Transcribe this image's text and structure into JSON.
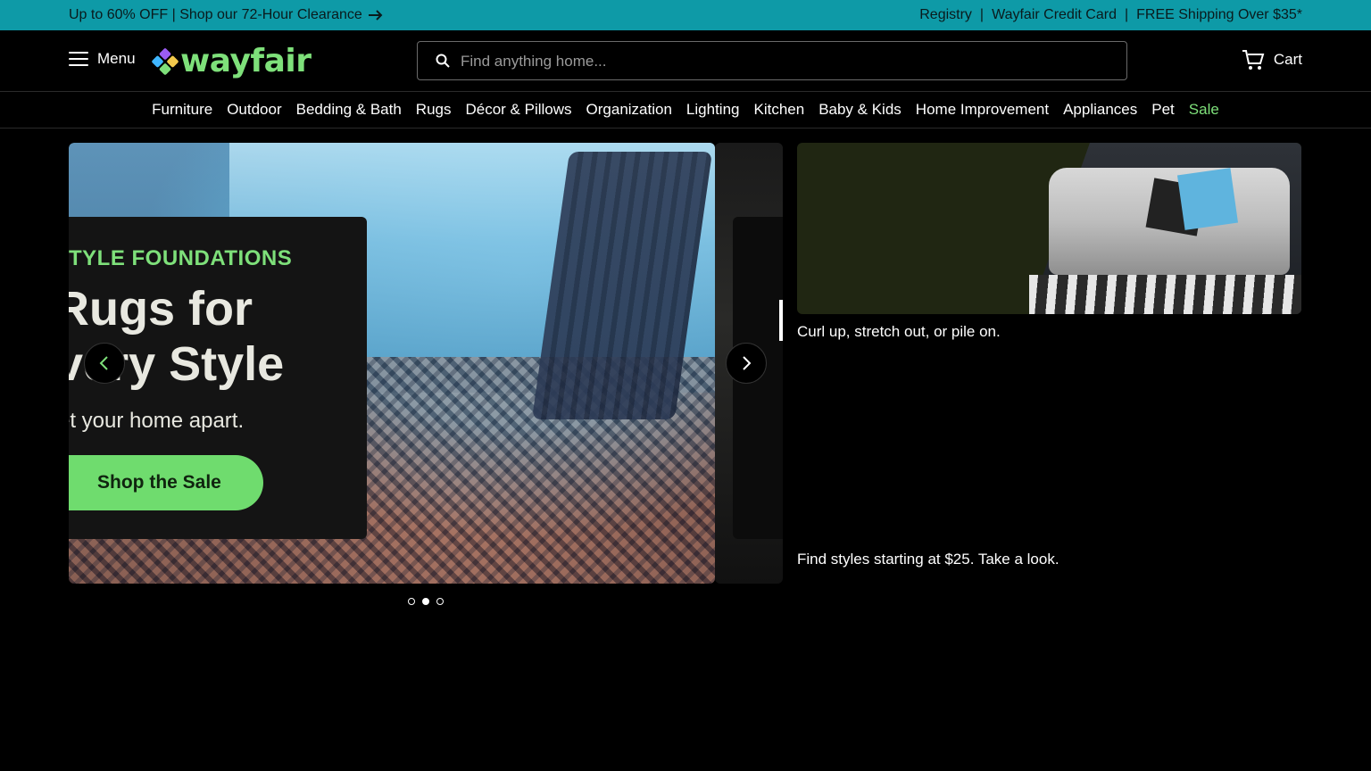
{
  "promo_bar": {
    "left_text": "Up to 60% OFF | Shop our 72-Hour Clearance",
    "links": [
      "Registry",
      "Wayfair Credit Card",
      "FREE Shipping Over $35*"
    ],
    "separator": "|"
  },
  "header": {
    "menu_label": "Menu",
    "logo_text": "wayfair",
    "search_placeholder": "Find anything home...",
    "cart_label": "Cart"
  },
  "nav": {
    "categories": [
      "Furniture",
      "Outdoor",
      "Bedding & Bath",
      "Rugs",
      "Décor & Pillows",
      "Organization",
      "Lighting",
      "Kitchen",
      "Baby & Kids",
      "Home Improvement",
      "Appliances",
      "Pet",
      "Sale"
    ]
  },
  "hero": {
    "eyebrow": "TYLE FOUNDATIONS",
    "headline_line1": "Rugs for",
    "headline_line2": "Every Style",
    "subtext": "et your home apart.",
    "cta_label": "Shop the Sale",
    "slide_count": 3,
    "active_slide": 2
  },
  "side_promo": {
    "caption1": "Curl up, stretch out, or pile on.",
    "caption2": "Find styles starting at $25. Take a look."
  },
  "colors": {
    "promo_bg": "#0e9aa7",
    "accent_green": "#7ee07a",
    "page_bg": "#000000"
  }
}
